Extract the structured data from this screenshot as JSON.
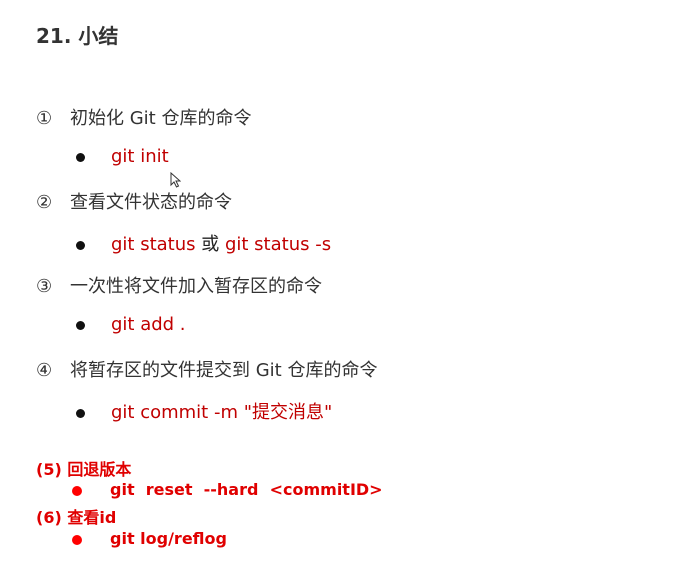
{
  "title": "21. 小结",
  "steps": [
    {
      "num": "①",
      "label": "初始化 Git 仓库的命令"
    },
    {
      "num": "②",
      "label": "查看文件状态的命令"
    },
    {
      "num": "③",
      "label": "一次性将文件加入暂存区的命令"
    },
    {
      "num": "④",
      "label": "将暂存区的文件提交到 Git 仓库的命令"
    }
  ],
  "commands": [
    {
      "text": "git init"
    },
    {
      "text": "git status",
      "sep": " 或 ",
      "text2": "git status -s"
    },
    {
      "text": "git add ."
    },
    {
      "text": "git commit -m \"提交消息\""
    }
  ],
  "extras": [
    {
      "label": "(5)  回退版本",
      "command": "git  reset  --hard  <commitID>"
    },
    {
      "label": "(6)  查看id",
      "command": "git log/reflog"
    }
  ],
  "colors": {
    "command_red": "#c00000",
    "extra_red": "#e00000"
  }
}
